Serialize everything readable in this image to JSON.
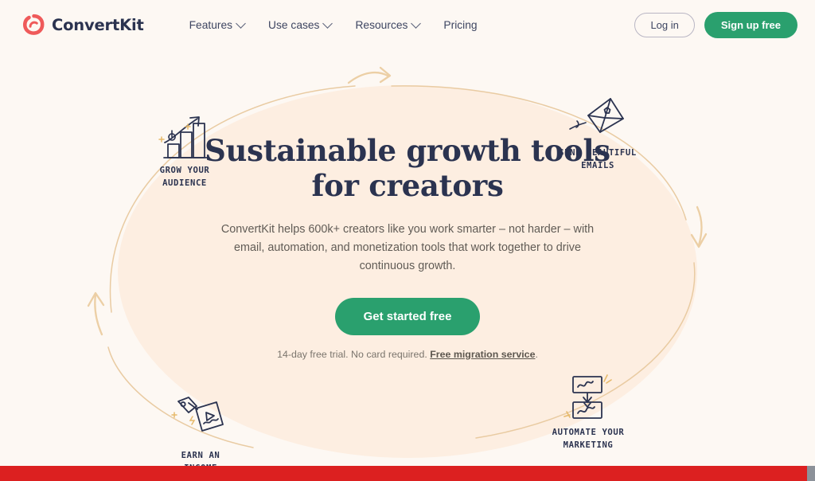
{
  "brand": {
    "name": "ConvertKit",
    "logo_icon": "convertkit-circle-logo",
    "logo_color": "#ef5a5a"
  },
  "nav": {
    "items": [
      {
        "label": "Features",
        "has_dropdown": true
      },
      {
        "label": "Use cases",
        "has_dropdown": true
      },
      {
        "label": "Resources",
        "has_dropdown": true
      },
      {
        "label": "Pricing",
        "has_dropdown": false
      }
    ]
  },
  "header_actions": {
    "login_label": "Log in",
    "signup_label": "Sign up free",
    "signup_color": "#2aa06e"
  },
  "hero": {
    "title_line1": "Sustainable growth tools",
    "title_line2": "for creators",
    "subtitle": "ConvertKit helps 600k+ creators like you work smarter – not harder – with email, automation, and monetization tools that work together to drive continuous growth.",
    "cta_label": "Get started free",
    "cta_color": "#2aa06e",
    "fineprint_before": "14-day free trial. No card required. ",
    "fineprint_link": "Free migration service",
    "fineprint_after": ".",
    "blob_color": "#fdeee1",
    "page_background": "#fdf8f3",
    "decor_color": "#eccfa5"
  },
  "callouts": [
    {
      "id": "grow-your-audience",
      "icon": "bar-chart-growth-icon",
      "label": "GROW YOUR\nAUDIENCE"
    },
    {
      "id": "send-beautiful-emails",
      "icon": "flying-envelope-icon",
      "label": "SEND BEAUTIFUL\nEMAILS"
    },
    {
      "id": "earn-an-income",
      "icon": "video-price-tag-icon",
      "label": "EARN AN\nINCOME"
    },
    {
      "id": "automate-your-marketing",
      "icon": "automation-flow-icon",
      "label": "AUTOMATE YOUR\nMARKETING"
    }
  ],
  "bottom_band": {
    "color": "#dc2020"
  }
}
